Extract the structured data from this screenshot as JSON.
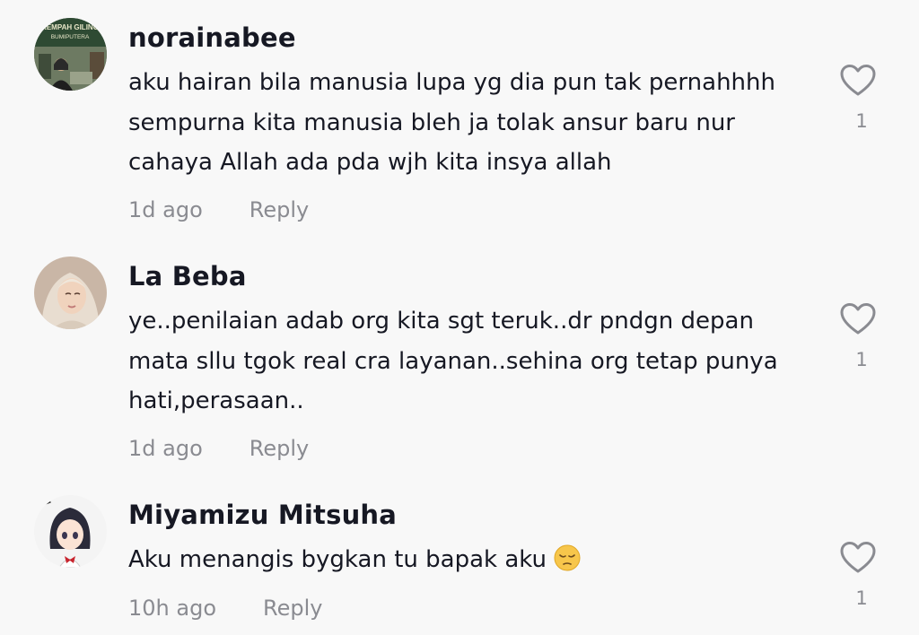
{
  "comments": [
    {
      "username": "norainabee",
      "text": "aku hairan bila manusia lupa yg dia pun tak pernahhhh sempurna kita manusia bleh ja tolak ansur baru nur cahaya Allah ada pda wjh kita insya allah",
      "time": "1d ago",
      "reply_label": "Reply",
      "likes": "1",
      "avatar_text": "REMPAH GILING BUMIPUTERA"
    },
    {
      "username": "La Beba",
      "text": "ye..penilaian adab org kita sgt teruk..dr pndgn depan mata sllu tgok real cra layanan..sehina org tetap punya hati,perasaan..",
      "time": "1d ago",
      "reply_label": "Reply",
      "likes": "1"
    },
    {
      "username": "Miyamizu Mitsuha",
      "text": "Aku menangis bygkan tu bapak aku",
      "emoji": "pensive-face",
      "time": "10h ago",
      "reply_label": "Reply",
      "likes": "1"
    }
  ],
  "colors": {
    "background": "#f8f8f8",
    "text": "#161823",
    "secondary": "#8a8b91",
    "heart_outline": "#8a8b91"
  },
  "icons": [
    "heart-outline-icon",
    "pensive-face-emoji"
  ]
}
